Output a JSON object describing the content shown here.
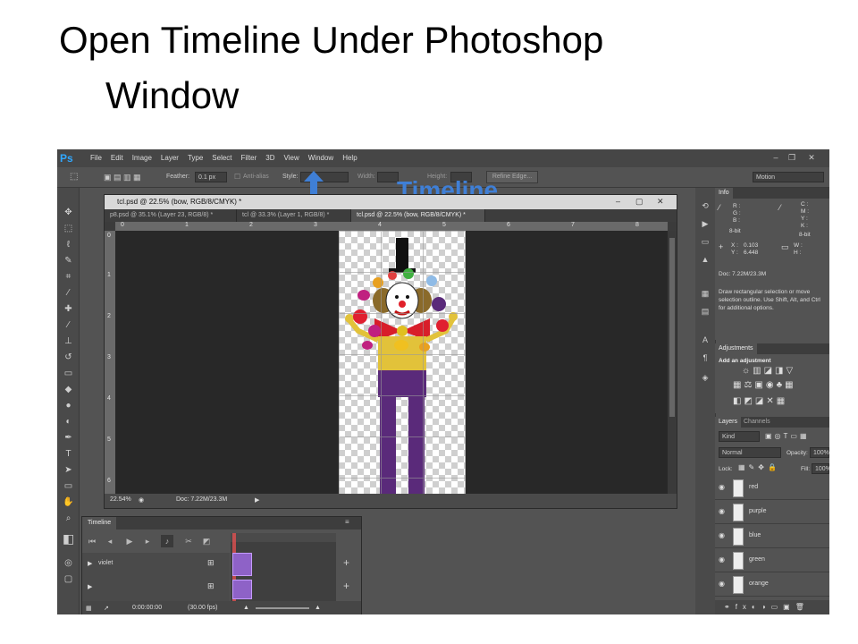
{
  "slide": {
    "title_line1": "Open Timeline Under Photoshop",
    "title_line2": "Window",
    "annotation": "Timeline"
  },
  "app": {
    "logo": "Ps",
    "menus": [
      "File",
      "Edit",
      "Image",
      "Layer",
      "Type",
      "Select",
      "Filter",
      "3D",
      "View",
      "Window",
      "Help"
    ],
    "workspace": "Motion"
  },
  "options_bar": {
    "feather_label": "Feather:",
    "feather_value": "0.1 px",
    "antialias_label": "Anti-alias",
    "style_label": "Style:",
    "width_label": "Width:",
    "height_label": "Height:",
    "refine_label": "Refine Edge..."
  },
  "document": {
    "window_title": "tcl.psd @ 22.5% (bow, RGB/8/CMYK) *",
    "tabs": [
      {
        "label": "p8.psd @ 35.1% (Layer 23, RGB/8) *"
      },
      {
        "label": "tcl @ 33.3% (Layer 1, RGB/8) *"
      },
      {
        "label": "tcl.psd @ 22.5% (bow, RGB/8/CMYK) *"
      }
    ],
    "ruler_h": [
      "0",
      "1",
      "2",
      "3",
      "4",
      "5",
      "6",
      "7",
      "8"
    ],
    "ruler_v": [
      "0",
      "1",
      "2",
      "3",
      "4",
      "5",
      "6"
    ],
    "zoom": "22.54%",
    "doc_size": "Doc: 7.22M/23.3M"
  },
  "timeline": {
    "tab_label": "Timeline",
    "tracks": [
      "violet",
      ""
    ],
    "timecode": "0:00:00:00",
    "fps": "(30.00 fps)"
  },
  "info_panel": {
    "tab": "Info",
    "rgb": [
      "R :",
      "G :",
      "B :"
    ],
    "cmyk": [
      "C :",
      "M :",
      "Y :",
      "K :"
    ],
    "bit_left": "8-bit",
    "bit_right": "8-bit",
    "x": "X :",
    "x_val": "0.103",
    "y": "Y :",
    "y_val": "6.448",
    "w": "W :",
    "h": "H :",
    "doc": "Doc: 7.22M/23.3M",
    "hint": "Draw rectangular selection or move selection outline. Use Shift, Alt, and Ctrl for additional options."
  },
  "adjustments_panel": {
    "tab": "Adjustments",
    "heading": "Add an adjustment"
  },
  "layers_panel": {
    "tabs": [
      "Layers",
      "Channels"
    ],
    "kind": "Kind",
    "blend_mode": "Normal",
    "opacity_label": "Opacity:",
    "opacity_value": "100%",
    "lock_label": "Lock:",
    "fill_label": "Fill:",
    "fill_value": "100%",
    "layers": [
      "red",
      "purple",
      "blue",
      "green",
      "orange"
    ]
  }
}
